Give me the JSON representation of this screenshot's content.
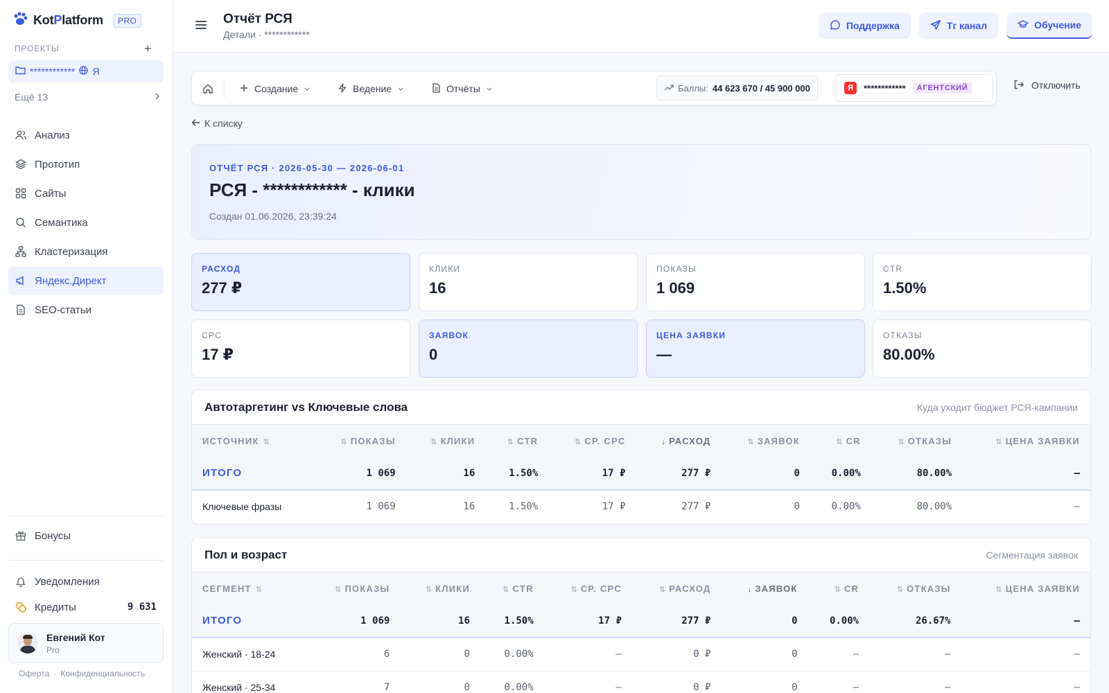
{
  "sidebar": {
    "logo_part1": "Kot",
    "logo_part2": "P",
    "logo_part3": "latform",
    "plan_badge": "PRO",
    "projects_label": "ПРОЕКТЫ",
    "project_name": "************",
    "project_engine": "Я",
    "more_label": "Ещё 13",
    "nav": [
      {
        "label": "Анализ",
        "icon": "users-icon"
      },
      {
        "label": "Прототип",
        "icon": "layers-icon"
      },
      {
        "label": "Сайты",
        "icon": "grid-icon"
      },
      {
        "label": "Семантика",
        "icon": "search-icon"
      },
      {
        "label": "Кластеризация",
        "icon": "cluster-icon"
      },
      {
        "label": "Яндекс.Директ",
        "icon": "megaphone-icon",
        "active": true
      },
      {
        "label": "SEO-статьи",
        "icon": "document-icon"
      }
    ],
    "bonuses": "Бонусы",
    "notifications": "Уведомления",
    "credits_label": "Кредиты",
    "credits_value": "9 631",
    "user_name": "Евгений Кот",
    "user_plan": "Pro",
    "footer_offer": "Оферта",
    "footer_sep": "·",
    "footer_privacy": "Конфиденциальность"
  },
  "header": {
    "title": "Отчёт РСЯ",
    "subtitle": "Детали · ************",
    "support": "Поддержка",
    "tg": "Тг канал",
    "learning": "Обучение"
  },
  "toolbar": {
    "create": "Создание",
    "manage": "Ведение",
    "reports": "Отчёты",
    "points_label": "Баллы:",
    "points_value": "44 623 670 / 45 900 000",
    "account_name": "************",
    "account_badge": "АГЕНТСКИЙ",
    "ya_letter": "Я",
    "disconnect": "Отключить"
  },
  "back_link": "К списку",
  "report": {
    "kicker": "ОТЧЁТ РСЯ · 2026-05-30 — 2026-06-01",
    "title": "РСЯ - ************ - клики",
    "created": "Создан 01.06.2026, 23:39:24"
  },
  "kpis": [
    {
      "label": "РАСХОД",
      "value": "277 ₽",
      "highlight": true
    },
    {
      "label": "КЛИКИ",
      "value": "16",
      "highlight": false
    },
    {
      "label": "ПОКАЗЫ",
      "value": "1 069",
      "highlight": false
    },
    {
      "label": "CTR",
      "value": "1.50%",
      "highlight": false
    },
    {
      "label": "CPC",
      "value": "17 ₽",
      "highlight": false
    },
    {
      "label": "ЗАЯВОК",
      "value": "0",
      "highlight": true
    },
    {
      "label": "ЦЕНА ЗАЯВКИ",
      "value": "—",
      "highlight": true
    },
    {
      "label": "ОТКАЗЫ",
      "value": "80.00%",
      "highlight": false
    }
  ],
  "table1": {
    "title": "Автотаргетинг vs Ключевые слова",
    "subtitle": "Куда уходит бюджет РСЯ-кампании",
    "columns": [
      "ИСТОЧНИК",
      "ПОКАЗЫ",
      "КЛИКИ",
      "CTR",
      "СР. CPC",
      "РАСХОД",
      "ЗАЯВОК",
      "CR",
      "ОТКАЗЫ",
      "ЦЕНА ЗАЯВКИ"
    ],
    "sorted_column": 5,
    "total": [
      "ИТОГО",
      "1 069",
      "16",
      "1.50%",
      "17 ₽",
      "277 ₽",
      "0",
      "0.00%",
      "80.00%",
      "—"
    ],
    "rows": [
      [
        "Ключевые фразы",
        "1 069",
        "16",
        "1.50%",
        "17 ₽",
        "277 ₽",
        "0",
        "0.00%",
        "80.00%",
        "—"
      ]
    ]
  },
  "table2": {
    "title": "Пол и возраст",
    "subtitle": "Сегментация заявок",
    "columns": [
      "СЕГМЕНТ",
      "ПОКАЗЫ",
      "КЛИКИ",
      "CTR",
      "СР. CPC",
      "РАСХОД",
      "ЗАЯВОК",
      "CR",
      "ОТКАЗЫ",
      "ЦЕНА ЗАЯВКИ"
    ],
    "sorted_column": 6,
    "total": [
      "ИТОГО",
      "1 069",
      "16",
      "1.50%",
      "17 ₽",
      "277 ₽",
      "0",
      "0.00%",
      "26.67%",
      "—"
    ],
    "rows": [
      [
        "Женский · 18-24",
        "6",
        "0",
        "0.00%",
        "—",
        "0 ₽",
        "0",
        "—",
        "—",
        "—"
      ],
      [
        "Женский · 25-34",
        "7",
        "0",
        "0.00%",
        "—",
        "0 ₽",
        "0",
        "—",
        "—",
        "—"
      ]
    ]
  },
  "colors": {
    "accent": "#3b5bdb",
    "accent_bg": "#eef1ff",
    "agency": "#8b3fd1",
    "yandex": "#ff3333"
  }
}
